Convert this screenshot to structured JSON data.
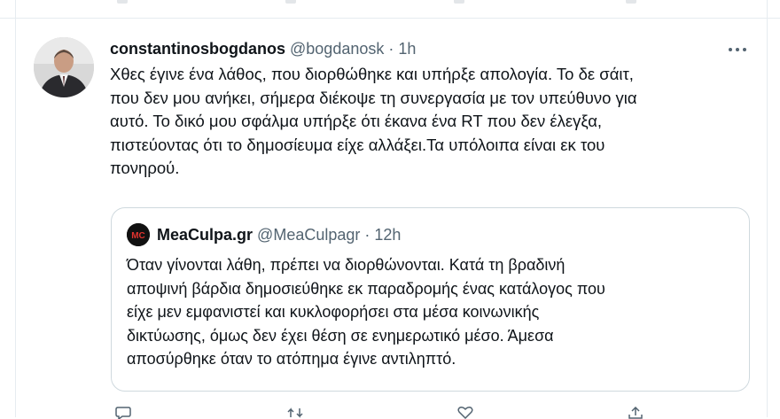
{
  "tweet": {
    "display_name": "constantinosbogdanos",
    "handle": "@bogdanosk",
    "dot": "·",
    "time": "1h",
    "text_lines": [
      "Χθες έγινε ένα λάθος, που διορθώθηκε και υπήρξε απολογία. Το δε σάιτ,",
      "που δεν μου ανήκει, σήμερα διέκοψε τη συνεργασία με τον υπεύθυνο για",
      "αυτό. Το δικό μου σφάλμα υπήρξε ότι έκανα ένα RT που δεν έλεγξα,",
      "πιστεύοντας ότι το δημοσίευμα είχε αλλάξει.Τα υπόλοιπα είναι εκ του",
      "πονηρού."
    ]
  },
  "quote": {
    "display_name": "MeaCulpa.gr",
    "handle": "@MeaCulpagr",
    "dot": "·",
    "time": "12h",
    "avatar_text": "MC",
    "text_lines": [
      "Όταν γίνονται λάθη, πρέπει να διορθώνονται. Κατά τη βραδινή",
      "αποψινή βάρδια δημοσιεύθηκε εκ παραδρομής ένας κατάλογος που",
      "είχε μεν εμφανιστεί και κυκλοφορήσει στα μέσα κοινωνικής",
      "δικτύωσης, όμως δεν έχει θέση σε ενημερωτικό μέσο. Άμεσα",
      "αποσύρθηκε όταν το ατόπημα έγινε αντιληπτό."
    ]
  },
  "icons": {
    "more": "more-icon",
    "reply": "reply-icon",
    "retweet": "retweet-icon",
    "like": "like-icon",
    "share": "share-icon"
  },
  "colors": {
    "text": "#0f1419",
    "secondary": "#536471",
    "border": "#cfd9de"
  }
}
